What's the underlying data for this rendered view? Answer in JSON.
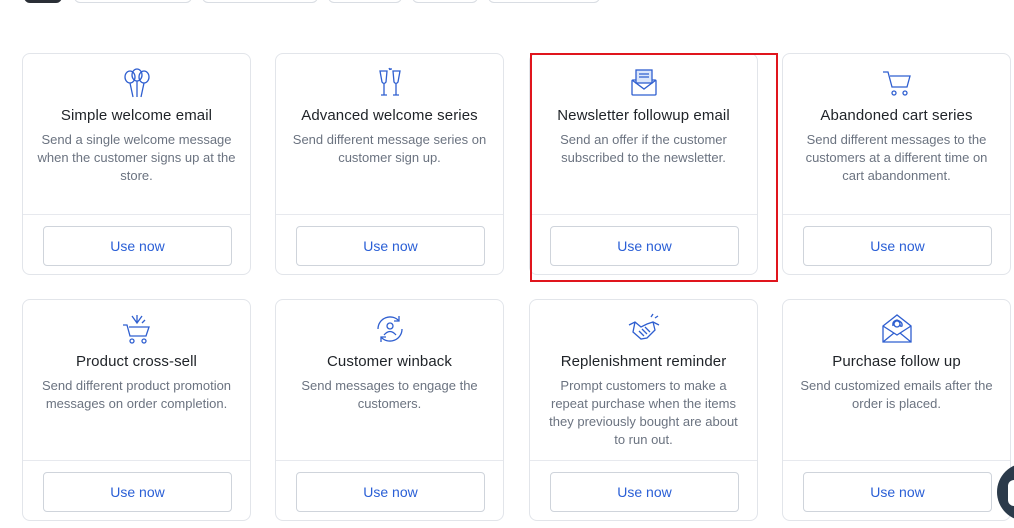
{
  "top_tabs": [
    "",
    "",
    "",
    "",
    "",
    ""
  ],
  "cards": [
    {
      "title": "Simple welcome email",
      "desc": "Send a single welcome message when the customer signs up at the store.",
      "button": "Use now",
      "icon": "balloons-icon"
    },
    {
      "title": "Advanced welcome series",
      "desc": "Send different message series on customer sign up.",
      "button": "Use now",
      "icon": "champagne-glasses-icon"
    },
    {
      "title": "Newsletter followup email",
      "desc": "Send an offer if the customer subscribed to the newsletter.",
      "button": "Use now",
      "icon": "newsletter-envelope-icon"
    },
    {
      "title": "Abandoned cart series",
      "desc": "Send different messages to the customers at a different time on cart abandonment.",
      "button": "Use now",
      "icon": "shopping-cart-icon"
    },
    {
      "title": "Product cross-sell",
      "desc": "Send different product promotion messages on order completion.",
      "button": "Use now",
      "icon": "cart-arrows-icon"
    },
    {
      "title": "Customer winback",
      "desc": "Send messages to engage the customers.",
      "button": "Use now",
      "icon": "user-refresh-icon"
    },
    {
      "title": "Replenishment reminder",
      "desc": "Prompt customers to make a repeat purchase when the items they previously bought are about to run out.",
      "button": "Use now",
      "icon": "handshake-icon"
    },
    {
      "title": "Purchase follow up",
      "desc": "Send customized emails after the order is placed.",
      "button": "Use now",
      "icon": "email-at-icon"
    }
  ],
  "colors": {
    "accent": "#2a5fd6",
    "icon": "#2f5fd0",
    "highlight": "#e0151d",
    "title": "#1f2328",
    "desc": "#6b7380"
  }
}
